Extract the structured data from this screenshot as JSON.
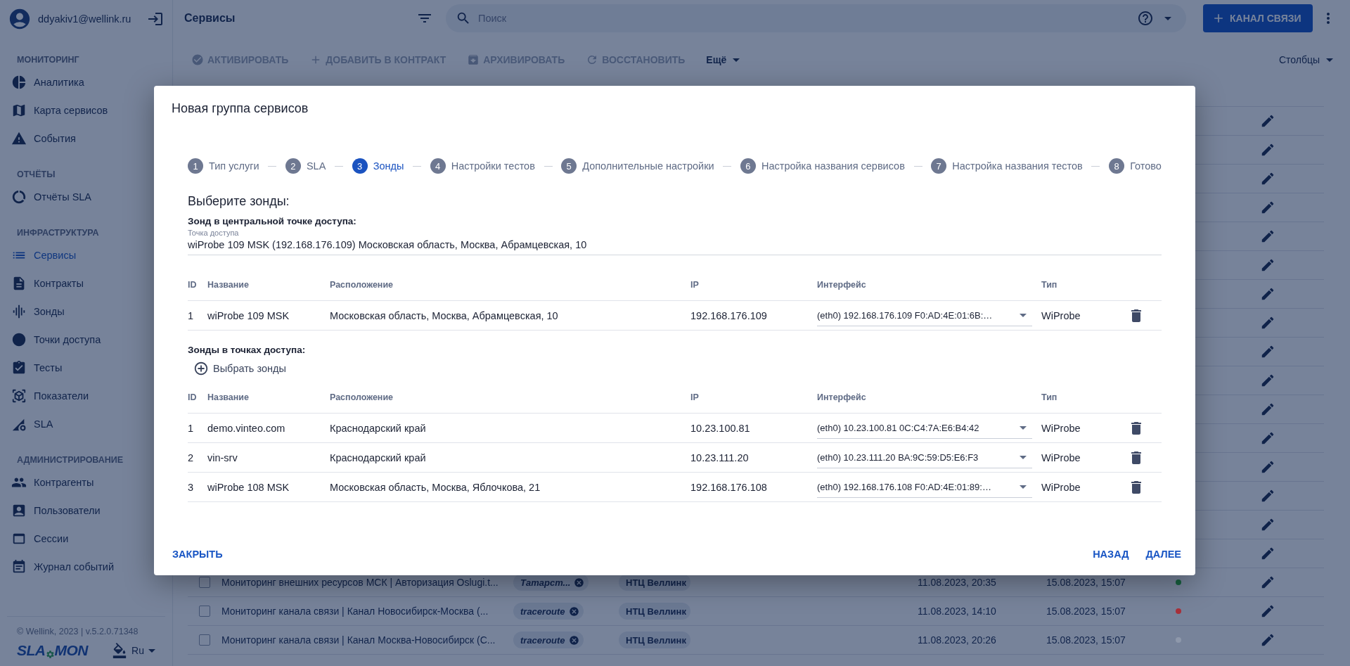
{
  "user": {
    "email": "ddyakiv1@wellink.ru"
  },
  "sidebar": {
    "sections": [
      {
        "title": "МОНИТОРИНГ",
        "items": [
          {
            "label": "Аналитика",
            "selected": false
          },
          {
            "label": "Карта сервисов",
            "selected": false
          },
          {
            "label": "События",
            "selected": false
          }
        ]
      },
      {
        "title": "ОТЧЁТЫ",
        "items": [
          {
            "label": "Отчёты SLA",
            "selected": false
          }
        ]
      },
      {
        "title": "ИНФРАСТРУКТУРА",
        "items": [
          {
            "label": "Сервисы",
            "selected": true
          },
          {
            "label": "Контракты",
            "selected": false
          },
          {
            "label": "Зонды",
            "selected": false
          },
          {
            "label": "Точки доступа",
            "selected": false
          },
          {
            "label": "Тесты",
            "selected": false
          },
          {
            "label": "Показатели",
            "selected": false
          },
          {
            "label": "SLA",
            "selected": false
          }
        ]
      },
      {
        "title": "АДМИНИСТРИРОВАНИЕ",
        "items": [
          {
            "label": "Контрагенты",
            "selected": false
          },
          {
            "label": "Пользователи",
            "selected": false
          },
          {
            "label": "Сессии",
            "selected": false
          },
          {
            "label": "Журнал событий",
            "selected": false
          }
        ]
      }
    ],
    "copyright": "© Wellink, 2023 | v.5.2.0.71348",
    "logo": [
      "SLA",
      "MON"
    ],
    "language": "Ru"
  },
  "topbar": {
    "title": "Сервисы",
    "search": {
      "placeholder": "Поиск"
    },
    "primary_button": "КАНАЛ СВЯЗИ"
  },
  "toolbar": {
    "actions": [
      {
        "label": "АКТИВИРОВАТЬ",
        "disabled": true
      },
      {
        "label": "ДОБАВИТЬ В КОНТРАКТ",
        "disabled": true
      },
      {
        "label": "АРХИВИРОВАТЬ",
        "disabled": true
      },
      {
        "label": "ВОССТАНОВИТЬ",
        "disabled": true
      }
    ],
    "more": "Ещё",
    "columns": "Столбцы"
  },
  "table": {
    "rows": [
      {
        "kind": "covered"
      },
      {
        "kind": "covered"
      },
      {
        "kind": "covered"
      },
      {
        "kind": "covered"
      },
      {
        "kind": "covered"
      },
      {
        "kind": "covered"
      },
      {
        "kind": "covered"
      },
      {
        "kind": "covered"
      },
      {
        "kind": "covered"
      },
      {
        "kind": "covered"
      },
      {
        "kind": "covered"
      },
      {
        "kind": "covered"
      },
      {
        "kind": "covered"
      },
      {
        "kind": "covered"
      },
      {
        "kind": "covered"
      },
      {
        "kind": "covered"
      },
      {
        "kind": "service",
        "checked": false,
        "name": "Мониторинг внешних ресурсов МСК | Авторизация Oslugi.t...",
        "tag": "Татарст...",
        "org": "НТЦ Веллинк",
        "created": "11.08.2023, 20:35",
        "updated": "15.08.2023, 15:07",
        "color": "#17603f"
      },
      {
        "kind": "service",
        "checked": false,
        "name": "Мониторинг канала связи | Канал Новосибирск-Москва (...",
        "tag": "traceroute",
        "org": "НТЦ Веллинк",
        "created": "11.08.2023, 14:10",
        "updated": "15.08.2023, 15:07",
        "color": "#a8303a"
      },
      {
        "kind": "service",
        "checked": false,
        "name": "Мониторинг канала связи | Канал Москва-Новосибирск (С...",
        "tag": "traceroute",
        "org": "НТЦ Веллинк",
        "created": "11.08.2023, 20:26",
        "updated": "15.08.2023, 15:07",
        "color": "#8e98ab"
      }
    ]
  },
  "modal": {
    "title": "Новая группа сервисов",
    "steps": [
      {
        "number": "1",
        "label": "Тип услуги",
        "selected": false
      },
      {
        "number": "2",
        "label": "SLA",
        "selected": false
      },
      {
        "number": "3",
        "label": "Зонды",
        "selected": true
      },
      {
        "number": "4",
        "label": "Настройки тестов",
        "selected": false
      },
      {
        "number": "5",
        "label": "Дополнительные настройки",
        "selected": false
      },
      {
        "number": "6",
        "label": "Настройка названия сервисов",
        "selected": false
      },
      {
        "number": "7",
        "label": "Настройка названия тестов",
        "selected": false
      },
      {
        "number": "8",
        "label": "Готово",
        "selected": false
      }
    ],
    "heading": "Выберите зонды:",
    "central": {
      "title": "Зонд в центральной точке доступа:",
      "field": {
        "label": "Точка доступа",
        "value": "wiProbe 109 MSK (192.168.176.109) Московская область, Москва, Абрамцевская, 10"
      },
      "columns": [
        "ID",
        "Название",
        "Расположение",
        "IP",
        "Интерфейс",
        "Тип"
      ],
      "rows": [
        {
          "id": "1",
          "name": "wiProbe 109 MSK",
          "location": "Московская область, Москва, Абрамцевская, 10",
          "ip": "192.168.176.109",
          "interface": "(eth0) 192.168.176.109 F0:AD:4E:01:6B:…",
          "type": "WiProbe"
        }
      ]
    },
    "access": {
      "title": "Зонды в точках доступа:",
      "add_button": "Выбрать зонды",
      "columns": [
        "ID",
        "Название",
        "Расположение",
        "IP",
        "Интерфейс",
        "Тип"
      ],
      "rows": [
        {
          "id": "1",
          "name": "demo.vinteo.com",
          "location": "Краснодарский край",
          "ip": "10.23.100.81",
          "interface": "(eth0) 10.23.100.81 0C:C4:7A:E6:B4:42",
          "type": "WiProbe"
        },
        {
          "id": "2",
          "name": "vin-srv",
          "location": "Краснодарский край",
          "ip": "10.23.111.20",
          "interface": "(eth0) 10.23.111.20 BA:9C:59:D5:E6:F3",
          "type": "WiProbe"
        },
        {
          "id": "3",
          "name": "wiProbe 108 MSK",
          "location": "Московская область, Москва, Яблочкова, 21",
          "ip": "192.168.176.108",
          "interface": "(eth0) 192.168.176.108 F0:AD:4E:01:89:…",
          "type": "WiProbe"
        }
      ]
    },
    "close_button": "ЗАКРЫТЬ",
    "back_button": "НАЗАД",
    "next_button": "ДАЛЕЕ"
  }
}
